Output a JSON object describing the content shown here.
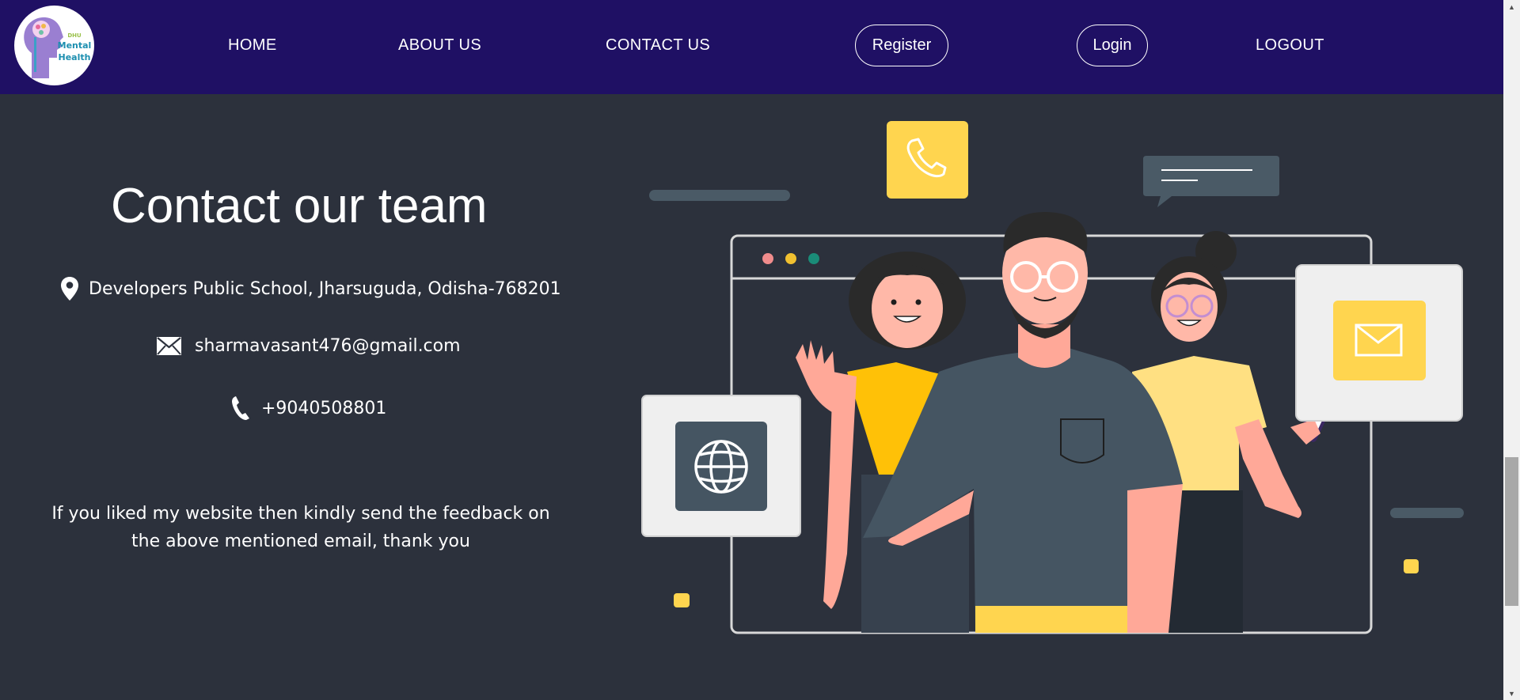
{
  "brand": {
    "logo_small_text": "DHU",
    "logo_line1": "Mental",
    "logo_line2": "Health"
  },
  "nav": {
    "home": "HOME",
    "about": "ABOUT US",
    "contact": "CONTACT US",
    "register": "Register",
    "login": "Login",
    "logout": "LOGOUT"
  },
  "contact": {
    "heading": "Contact our team",
    "address": "Developers Public School, Jharsuguda, Odisha-768201",
    "email": "sharmavasant476@gmail.com",
    "phone": "+9040508801",
    "feedback": "If you liked my website then kindly send the feedback on the above mentioned email, thank you"
  },
  "colors": {
    "navbar_bg": "#1f1064",
    "page_bg": "#2c313c",
    "accent_yellow": "#ffd54f",
    "text": "#ffffff"
  },
  "icons": {
    "address": "location-pin-icon",
    "email": "envelope-icon",
    "phone": "phone-icon"
  }
}
